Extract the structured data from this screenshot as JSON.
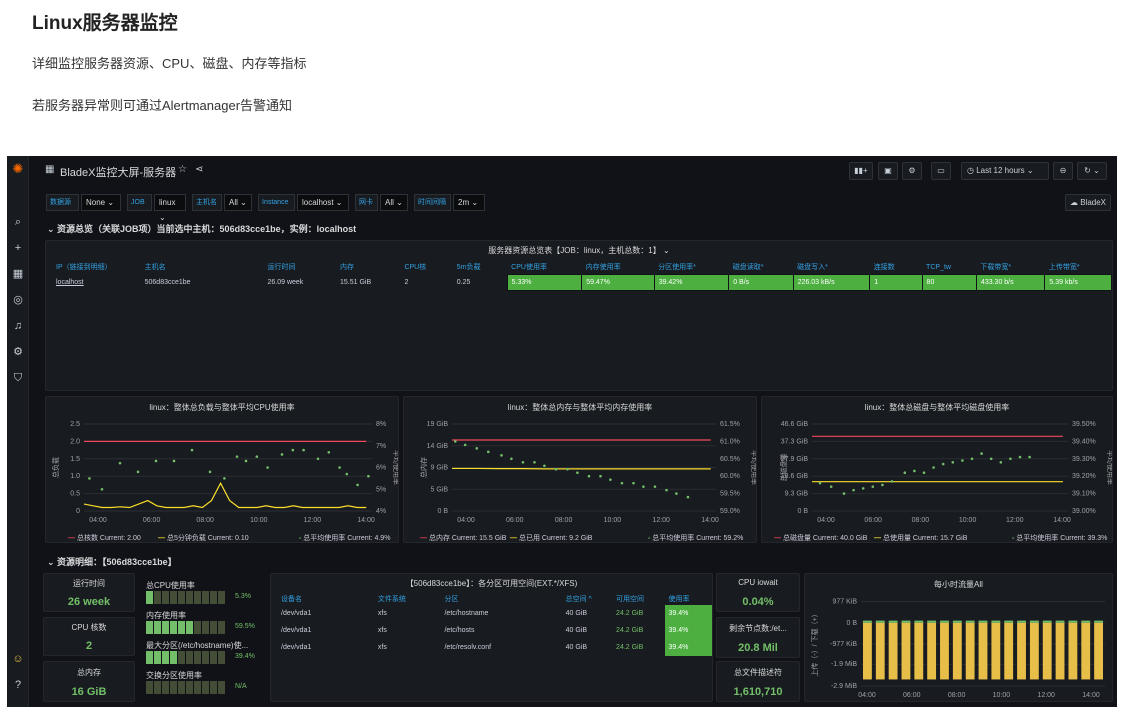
{
  "doc": {
    "title": "Linux服务器监控",
    "line1": "详细监控服务器资源、CPU、磁盘、内存等指标",
    "line2": "若服务器异常则可通过Alertmanager告警通知"
  },
  "grafana": {
    "dashboard_title": "BladeX监控大屏-服务器",
    "time_range": "Last 12 hours",
    "org_button": "BladeX",
    "colors": {
      "green": "#73bf69",
      "red": "#f2495c",
      "yellow": "#fade2a",
      "blue": "#33a2e5",
      "bar": "#e7be47"
    },
    "variables": [
      {
        "label": "数据源",
        "value": "None"
      },
      {
        "label": "JOB",
        "value": "linux"
      },
      {
        "label": "主机名",
        "value": "All"
      },
      {
        "label": "Instance",
        "value": "localhost"
      },
      {
        "label": "网卡",
        "value": "All"
      },
      {
        "label": "时间间隔",
        "value": "2m"
      }
    ],
    "row1_title": "资源总览（关联JOB项）当前选中主机：506d83cce1be，实例：localhost",
    "table_title": "服务器资源总览表【JOB：linux，主机总数：1】",
    "table_headers": [
      "IP（链接到明细）",
      "主机名",
      "运行时间",
      "内存",
      "CPU核",
      "5m负载",
      "CPU使用率",
      "内存使用率",
      "分区使用率*",
      "磁盘读取*",
      "磁盘写入*",
      "连接数",
      "TCP_tw",
      "下载带宽*",
      "上传带宽*"
    ],
    "table_row": [
      "localhost",
      "506d83cce1be",
      "26.09 week",
      "15.51 GiB",
      "2",
      "0.25",
      "5.33%",
      "59.47%",
      "39.42%",
      "0 B/s",
      "226.03 kB/s",
      "1",
      "80",
      "433.30 b/s",
      "5.39 kb/s"
    ],
    "chart_titles": [
      "linux：整体总负载与整体平均CPU使用率",
      "linux：整体总内存与整体平均内存使用率",
      "linux：整体总磁盘与整体平均磁盘使用率"
    ],
    "cpu_legend": {
      "a": "总核数  Current: 2.00",
      "b": "总5分钟负载  Current: 0.10",
      "c": "总平均使用率  Current: 4.9%"
    },
    "mem_legend": {
      "a": "总内存  Current: 15.5 GiB",
      "b": "总已用  Current: 9.2 GiB",
      "c": "总平均使用率  Current: 59.2%"
    },
    "disk_legend": {
      "a": "总磁盘量  Current: 40.0 GiB",
      "b": "总使用量  Current: 15.7 GiB",
      "c": "总平均使用率  Current: 39.3%"
    },
    "row2_title": "资源明细：【506d83cce1be】",
    "stats": {
      "uptime_label": "运行时间",
      "uptime": "26 week",
      "cores_label": "CPU 核数",
      "cores": "2",
      "memory_label": "总内存",
      "memory": "16 GiB",
      "iowait_label": "CPU iowait",
      "iowait": "0.04%",
      "inodes_label": "剩余节点数:/et...",
      "inodes": "20.8 Mil",
      "fd_label": "总文件描述符",
      "fd": "1,610,710"
    },
    "bargauges": [
      {
        "label": "总CPU使用率",
        "value": "5.3%",
        "fill": 0.053
      },
      {
        "label": "内存使用率",
        "value": "59.5%",
        "fill": 0.595
      },
      {
        "label": "最大分区(/etc/hostname)使...",
        "value": "39.4%",
        "fill": 0.394
      },
      {
        "label": "交换分区使用率",
        "value": "N/A",
        "fill": 0
      }
    ],
    "fs_table": {
      "title": "【506d83cce1be】：各分区可用空间(EXT.*/XFS)",
      "headers": [
        "设备名",
        "文件系统",
        "分区",
        "总空间 ^",
        "可用空间",
        "使用率"
      ],
      "rows": [
        [
          "/dev/vda1",
          "xfs",
          "/etc/hostname",
          "40 GiB",
          "24.2 GiB",
          "39.4%"
        ],
        [
          "/dev/vda1",
          "xfs",
          "/etc/hosts",
          "40 GiB",
          "24.2 GiB",
          "39.4%"
        ],
        [
          "/dev/vda1",
          "xfs",
          "/etc/resolv.conf",
          "40 GiB",
          "24.2 GiB",
          "39.4%"
        ]
      ]
    },
    "traffic_title": "每小时流量All",
    "traffic_ylabel": "上传（-）/ 下载（+）"
  },
  "chart_data": [
    {
      "type": "line",
      "title": "linux：整体总负载与整体平均CPU使用率",
      "xlabel": "",
      "ylabel": "总负载",
      "y2label": "平均使用率",
      "x_ticks": [
        "04:00",
        "06:00",
        "08:00",
        "10:00",
        "12:00",
        "14:00"
      ],
      "y_ticks": [
        "0",
        "0.5",
        "1.0",
        "1.5",
        "2.0",
        "2.5"
      ],
      "y2_ticks": [
        "4%",
        "5%",
        "6%",
        "7%",
        "8%"
      ],
      "ylim": [
        0,
        2.5
      ],
      "y2lim": [
        4,
        8
      ],
      "series": [
        {
          "name": "总核数",
          "axis": "left",
          "color": "#f2495c",
          "values": [
            2,
            2,
            2,
            2,
            2,
            2,
            2,
            2,
            2,
            2,
            2,
            2,
            2,
            2,
            2,
            2,
            2,
            2,
            2,
            2,
            2,
            2,
            2,
            2,
            2,
            2,
            2,
            2,
            2,
            2,
            2,
            2
          ]
        },
        {
          "name": "总5分钟负载",
          "axis": "left",
          "color": "#fade2a",
          "values": [
            0.2,
            0.15,
            0.1,
            0.1,
            0.12,
            0.1,
            0.2,
            0.3,
            0.15,
            0.1,
            0.1,
            0.1,
            0.15,
            0.1,
            0.3,
            0.8,
            0.3,
            0.1,
            0.1,
            0.1,
            0.15,
            0.1,
            0.1,
            0.15,
            0.1,
            0.1,
            0.1,
            0.1,
            0.1,
            0.15,
            0.1,
            0.1
          ]
        },
        {
          "name": "总平均使用率",
          "axis": "right",
          "color": "#73bf69",
          "style": "points",
          "points": [
            [
              0.3,
              5.5
            ],
            [
              1.0,
              5.0
            ],
            [
              2.0,
              6.2
            ],
            [
              3.0,
              5.8
            ],
            [
              4.0,
              6.3
            ],
            [
              5.0,
              6.3
            ],
            [
              6.0,
              6.8
            ],
            [
              7.0,
              5.8
            ],
            [
              7.8,
              5.5
            ],
            [
              8.5,
              6.5
            ],
            [
              9.0,
              6.3
            ],
            [
              9.6,
              6.5
            ],
            [
              10.2,
              6.0
            ],
            [
              11.0,
              6.6
            ],
            [
              11.6,
              6.8
            ],
            [
              12.2,
              6.8
            ],
            [
              13.0,
              6.4
            ],
            [
              13.6,
              6.7
            ],
            [
              14.2,
              6.0
            ],
            [
              14.6,
              5.7
            ],
            [
              15.2,
              5.2
            ],
            [
              15.8,
              5.6
            ]
          ]
        }
      ]
    },
    {
      "type": "line",
      "title": "linux：整体总内存与整体平均内存使用率",
      "xlabel": "",
      "ylabel": "总内存",
      "y2label": "平均使用率",
      "x_ticks": [
        "04:00",
        "06:00",
        "08:00",
        "10:00",
        "12:00",
        "14:00"
      ],
      "y_ticks": [
        "0 B",
        "5 GiB",
        "9 GiB",
        "14 GiB",
        "19 GiB"
      ],
      "y2_ticks": [
        "59.0%",
        "59.5%",
        "60.0%",
        "60.5%",
        "61.0%",
        "61.5%"
      ],
      "ylim": [
        0,
        19
      ],
      "y2lim": [
        59.0,
        61.5
      ],
      "series": [
        {
          "name": "总内存",
          "axis": "left",
          "color": "#f2495c",
          "values": [
            15.5,
            15.5,
            15.5,
            15.5,
            15.5,
            15.5,
            15.5,
            15.5,
            15.5,
            15.5,
            15.5,
            15.5
          ]
        },
        {
          "name": "总已用",
          "axis": "left",
          "color": "#fade2a",
          "values": [
            9.3,
            9.3,
            9.25,
            9.25,
            9.2,
            9.2,
            9.2,
            9.2,
            9.2,
            9.2,
            9.2,
            9.2
          ]
        },
        {
          "name": "总平均使用率",
          "axis": "right",
          "color": "#73bf69",
          "style": "points",
          "points": [
            [
              0.2,
              61.0
            ],
            [
              0.8,
              60.9
            ],
            [
              1.5,
              60.8
            ],
            [
              2.2,
              60.7
            ],
            [
              3.0,
              60.6
            ],
            [
              3.6,
              60.5
            ],
            [
              4.3,
              60.4
            ],
            [
              5.0,
              60.4
            ],
            [
              5.6,
              60.3
            ],
            [
              6.3,
              60.2
            ],
            [
              7.0,
              60.2
            ],
            [
              7.6,
              60.1
            ],
            [
              8.3,
              60.0
            ],
            [
              9.0,
              60.0
            ],
            [
              9.6,
              59.9
            ],
            [
              10.3,
              59.8
            ],
            [
              11.0,
              59.8
            ],
            [
              11.6,
              59.7
            ],
            [
              12.3,
              59.7
            ],
            [
              13.0,
              59.6
            ],
            [
              13.6,
              59.5
            ],
            [
              14.3,
              59.4
            ]
          ]
        }
      ]
    },
    {
      "type": "line",
      "title": "linux：整体总磁盘与整体平均磁盘使用率",
      "xlabel": "",
      "ylabel": "总磁盘量",
      "y2label": "平均使用率",
      "x_ticks": [
        "04:00",
        "06:00",
        "08:00",
        "10:00",
        "12:00",
        "14:00"
      ],
      "y_ticks": [
        "0 B",
        "9.3 GiB",
        "18.6 GiB",
        "27.9 GiB",
        "37.3 GiB",
        "46.6 GiB"
      ],
      "y2_ticks": [
        "39.00%",
        "39.10%",
        "39.20%",
        "39.30%",
        "39.40%",
        "39.50%"
      ],
      "ylim": [
        0,
        46.6
      ],
      "y2lim": [
        39.0,
        39.5
      ],
      "series": [
        {
          "name": "总磁盘量",
          "axis": "left",
          "color": "#f2495c",
          "values": [
            40,
            40,
            40,
            40,
            40,
            40,
            40,
            40,
            40,
            40
          ]
        },
        {
          "name": "总使用量",
          "axis": "left",
          "color": "#fade2a",
          "values": [
            15.7,
            15.7,
            15.7,
            15.7,
            15.7,
            15.7,
            15.7,
            15.7,
            15.7,
            15.7
          ]
        },
        {
          "name": "总平均使用率",
          "axis": "right",
          "color": "#73bf69",
          "style": "points",
          "points": [
            [
              0.5,
              39.16
            ],
            [
              1.2,
              39.14
            ],
            [
              2.0,
              39.1
            ],
            [
              2.6,
              39.12
            ],
            [
              3.2,
              39.13
            ],
            [
              3.8,
              39.14
            ],
            [
              4.4,
              39.15
            ],
            [
              5.0,
              39.17
            ],
            [
              5.8,
              39.22
            ],
            [
              6.4,
              39.23
            ],
            [
              7.0,
              39.22
            ],
            [
              7.6,
              39.25
            ],
            [
              8.2,
              39.27
            ],
            [
              8.8,
              39.28
            ],
            [
              9.4,
              39.29
            ],
            [
              10.0,
              39.3
            ],
            [
              10.6,
              39.33
            ],
            [
              11.2,
              39.3
            ],
            [
              11.8,
              39.28
            ],
            [
              12.4,
              39.3
            ],
            [
              13.0,
              39.31
            ],
            [
              13.6,
              39.31
            ]
          ]
        }
      ]
    },
    {
      "type": "bar",
      "title": "每小时流量All",
      "xlabel": "",
      "ylabel": "上传（-）/ 下载（+）",
      "x_ticks": [
        "04:00",
        "06:00",
        "08:00",
        "10:00",
        "12:00",
        "14:00"
      ],
      "y_ticks": [
        "977 KiB",
        "0 B",
        "-977 KiB",
        "-1.9 MiB",
        "-2.9 MiB"
      ],
      "ylim": [
        -2.9,
        1.0
      ],
      "series": [
        {
          "name": "下载",
          "values": [
            0.1,
            0.1,
            0.1,
            0.1,
            0.1,
            0.1,
            0.1,
            0.1,
            0.1,
            0.1,
            0.1,
            0.1,
            0.1,
            0.1,
            0.1,
            0.1,
            0.1,
            0.1,
            0.1
          ]
        },
        {
          "name": "上传",
          "values": [
            -2.6,
            -2.6,
            -2.6,
            -2.6,
            -2.6,
            -2.6,
            -2.6,
            -2.6,
            -2.6,
            -2.6,
            -2.6,
            -2.6,
            -2.6,
            -2.6,
            -2.6,
            -2.6,
            -2.6,
            -2.6,
            -2.6
          ]
        }
      ]
    }
  ]
}
